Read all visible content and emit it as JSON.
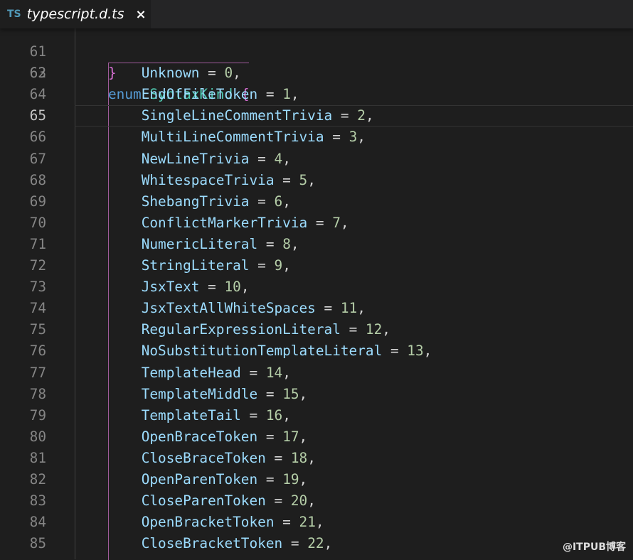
{
  "tab": {
    "icon": "typescript-icon",
    "icon_label": "TS",
    "title": "typescript.d.ts",
    "close_icon": "close-icon",
    "close_label": "×"
  },
  "editor": {
    "active_line": 65,
    "colors": {
      "keyword": "#569cd6",
      "type": "#4ec9b0",
      "brace": "#da70d6",
      "identifier": "#9cdcfe",
      "number": "#b5cea8",
      "background": "#1e1e1e"
    },
    "header_lines": [
      {
        "num": "61",
        "brace": "}"
      },
      {
        "num": "62",
        "keyword": "enum",
        "name": "SyntaxKind",
        "brace": "{"
      }
    ],
    "members": [
      {
        "num": "63",
        "name": "Unknown",
        "value": "0"
      },
      {
        "num": "64",
        "name": "EndOfFileToken",
        "value": "1"
      },
      {
        "num": "65",
        "name": "SingleLineCommentTrivia",
        "value": "2"
      },
      {
        "num": "66",
        "name": "MultiLineCommentTrivia",
        "value": "3"
      },
      {
        "num": "67",
        "name": "NewLineTrivia",
        "value": "4"
      },
      {
        "num": "68",
        "name": "WhitespaceTrivia",
        "value": "5"
      },
      {
        "num": "69",
        "name": "ShebangTrivia",
        "value": "6"
      },
      {
        "num": "70",
        "name": "ConflictMarkerTrivia",
        "value": "7"
      },
      {
        "num": "71",
        "name": "NumericLiteral",
        "value": "8"
      },
      {
        "num": "72",
        "name": "StringLiteral",
        "value": "9"
      },
      {
        "num": "73",
        "name": "JsxText",
        "value": "10"
      },
      {
        "num": "74",
        "name": "JsxTextAllWhiteSpaces",
        "value": "11"
      },
      {
        "num": "75",
        "name": "RegularExpressionLiteral",
        "value": "12"
      },
      {
        "num": "76",
        "name": "NoSubstitutionTemplateLiteral",
        "value": "13"
      },
      {
        "num": "77",
        "name": "TemplateHead",
        "value": "14"
      },
      {
        "num": "78",
        "name": "TemplateMiddle",
        "value": "15"
      },
      {
        "num": "79",
        "name": "TemplateTail",
        "value": "16"
      },
      {
        "num": "80",
        "name": "OpenBraceToken",
        "value": "17"
      },
      {
        "num": "81",
        "name": "CloseBraceToken",
        "value": "18"
      },
      {
        "num": "82",
        "name": "OpenParenToken",
        "value": "19"
      },
      {
        "num": "83",
        "name": "CloseParenToken",
        "value": "20"
      },
      {
        "num": "84",
        "name": "OpenBracketToken",
        "value": "21"
      },
      {
        "num": "85",
        "name": "CloseBracketToken",
        "value": "22"
      }
    ]
  },
  "watermark": "@ITPUB博客"
}
